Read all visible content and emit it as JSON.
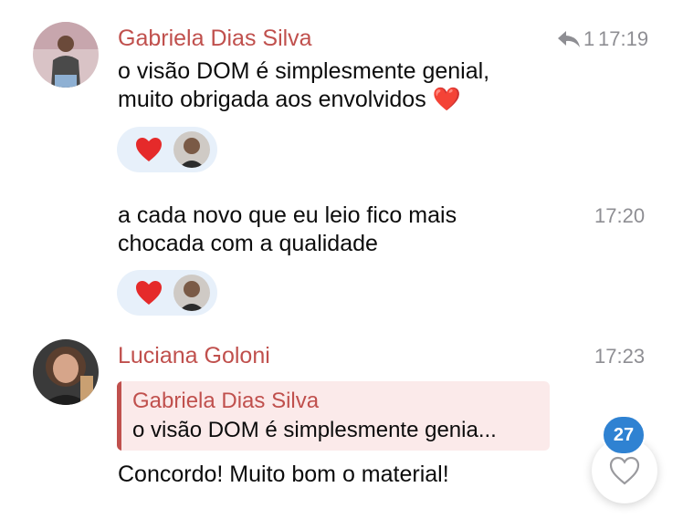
{
  "messages": [
    {
      "sender": "Gabriela Dias Silva",
      "reply_count": "1",
      "time": "17:19",
      "lines": [
        "o visão DOM é simplesmente genial,",
        "muito obrigada aos envolvidos ❤️"
      ],
      "reaction": "heart-emoji"
    },
    {
      "time": "17:20",
      "lines": [
        "a cada novo que eu leio fico mais",
        "chocada com a qualidade"
      ],
      "reaction": "heart-emoji"
    },
    {
      "sender": "Luciana Goloni",
      "time": "17:23",
      "quote": {
        "sender": "Gabriela Dias Silva",
        "text": "o visão DOM é simplesmente genia..."
      },
      "lines": [
        "Concordo! Muito bom o material!"
      ]
    }
  ],
  "unread_badge": "27",
  "colors": {
    "sender": "#c0504d",
    "timestamp": "#8e8e93",
    "reaction_bg": "#e7f0fa",
    "quote_bg": "#fbeaea",
    "badge": "#2f82d2"
  },
  "icons": [
    "reply-arrow-icon",
    "heart-emoji",
    "heart-outline-icon"
  ]
}
